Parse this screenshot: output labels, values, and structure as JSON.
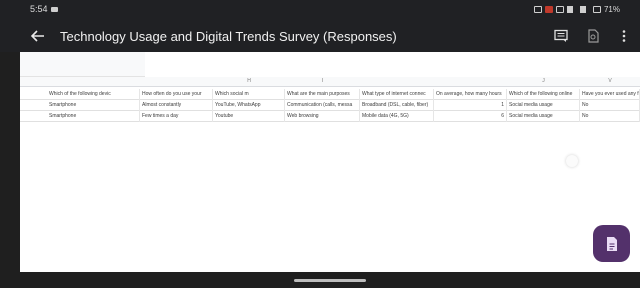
{
  "status_bar": {
    "time": "5:54",
    "battery": "71%"
  },
  "app_bar": {
    "title": "Technology Usage and Digital Trends Survey (Responses)",
    "icons": [
      "back-arrow-icon",
      "comment-icon",
      "view-icon",
      "more-vert-icon"
    ]
  },
  "sheet": {
    "column_letters": [
      "",
      "H",
      "I",
      "",
      "J",
      "",
      "V"
    ],
    "header_row": [
      "Which of the following devic",
      "How often do you use your",
      "Which social m",
      "What are the main purposes",
      "What type of internet connec",
      "On average, how many hours",
      "Which of the following online",
      "Have you ever used any form of digital wellbeing"
    ],
    "rows": [
      {
        "cells": [
          "Smartphone",
          "Almost constantly",
          "YouTube, WhatsApp",
          "Communication (calls, messa",
          "Broadband (DSL, cable, fiber)",
          "1",
          "Social media usage",
          "No"
        ]
      },
      {
        "cells": [
          "Smartphone",
          "Few times a day",
          "Youtube",
          "Web browsing",
          "Mobile data (4G, 5G)",
          "6",
          "Social media usage",
          "No"
        ]
      }
    ]
  },
  "fab": {
    "icon": "document-icon"
  },
  "colors": {
    "app_bar_bg": "#202124",
    "fab_bg": "#53316b",
    "sheet_bg": "#ffffff"
  }
}
